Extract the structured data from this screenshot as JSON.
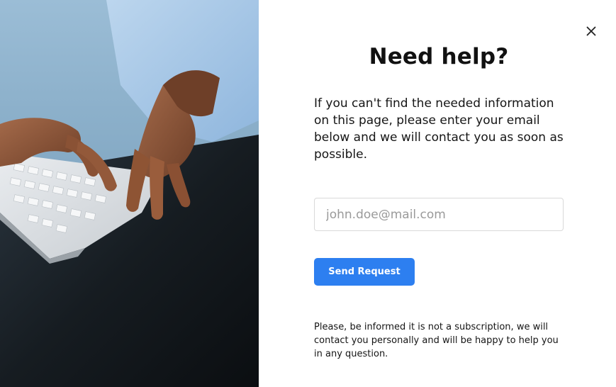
{
  "dialog": {
    "title": "Need help?",
    "description": "If you can't find the needed information on this page, please enter your email below and we will contact you as soon as possible.",
    "email": {
      "value": "",
      "placeholder": "john.doe@mail.com"
    },
    "send_label": "Send Request",
    "note": "Please, be informed it is not a subscription, we will contact you personally and will be happy to help you in any question.",
    "close_icon": "close-icon"
  },
  "photo": {
    "subject": "hands typing on keyboard"
  },
  "colors": {
    "accent": "#2d7ff0",
    "text": "#111111",
    "input_border": "#d9d9d9",
    "background": "#ffffff"
  }
}
